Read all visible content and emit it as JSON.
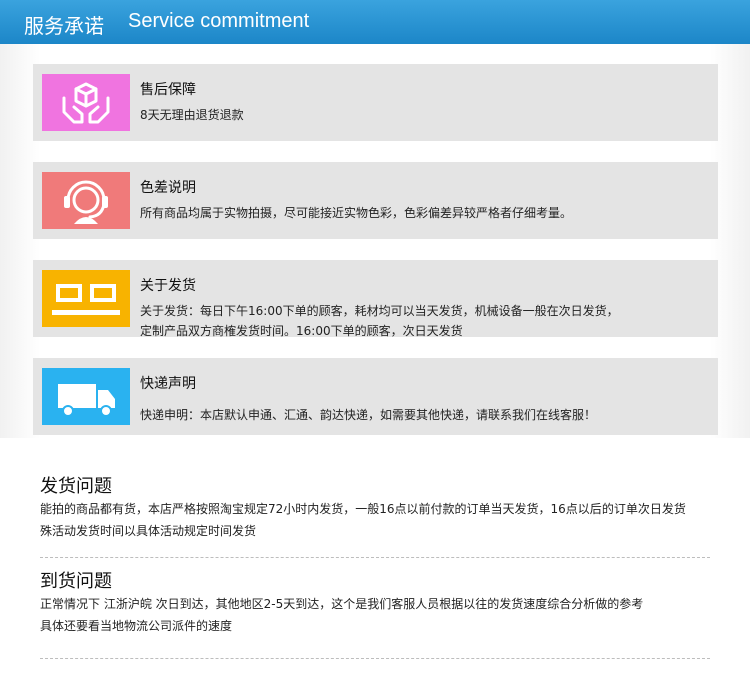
{
  "header": {
    "title_cn": "服务承诺",
    "title_en": "Service commitment"
  },
  "cards": [
    {
      "title": "售后保障",
      "desc_lines": [
        "8天无理由退货退款"
      ],
      "icon": "hands-package-icon",
      "color": "#f074e0"
    },
    {
      "title": "色差说明",
      "desc_lines": [
        "所有商品均属于实物拍摄，尽可能接近实物色彩，色彩偏差异较严格者仔细考量。"
      ],
      "icon": "headset-agent-icon",
      "color": "#f07a7a"
    },
    {
      "title": "关于发货",
      "desc_lines": [
        "关于发货：每日下午16:00下单的顾客，耗材均可以当天发货，机械设备一般在次日发货，",
        "定制产品双方商榷发货时间。16:00下单的顾客，次日天发货"
      ],
      "icon": "shipping-box-icon",
      "color": "#f8b300"
    },
    {
      "title": "快递声明",
      "desc_lines": [
        "快递申明：本店默认申通、汇通、韵达快递，如需要其他快递，请联系我们在线客服！"
      ],
      "icon": "delivery-truck-icon",
      "color": "#2ab2f0"
    }
  ],
  "faq": [
    {
      "title": "发货问题",
      "lines": [
        "能拍的商品都有货，本店严格按照淘宝规定72小时内发货，一般16点以前付款的订单当天发货，16点以后的订单次日发货",
        "殊活动发货时间以具体活动规定时间发货"
      ]
    },
    {
      "title": "到货问题",
      "lines": [
        "正常情况下 江浙沪皖 次日到达，其他地区2-5天到达，这个是我们客服人员根据以往的发货速度综合分析做的参考",
        "具体还要看当地物流公司派件的速度"
      ]
    }
  ]
}
